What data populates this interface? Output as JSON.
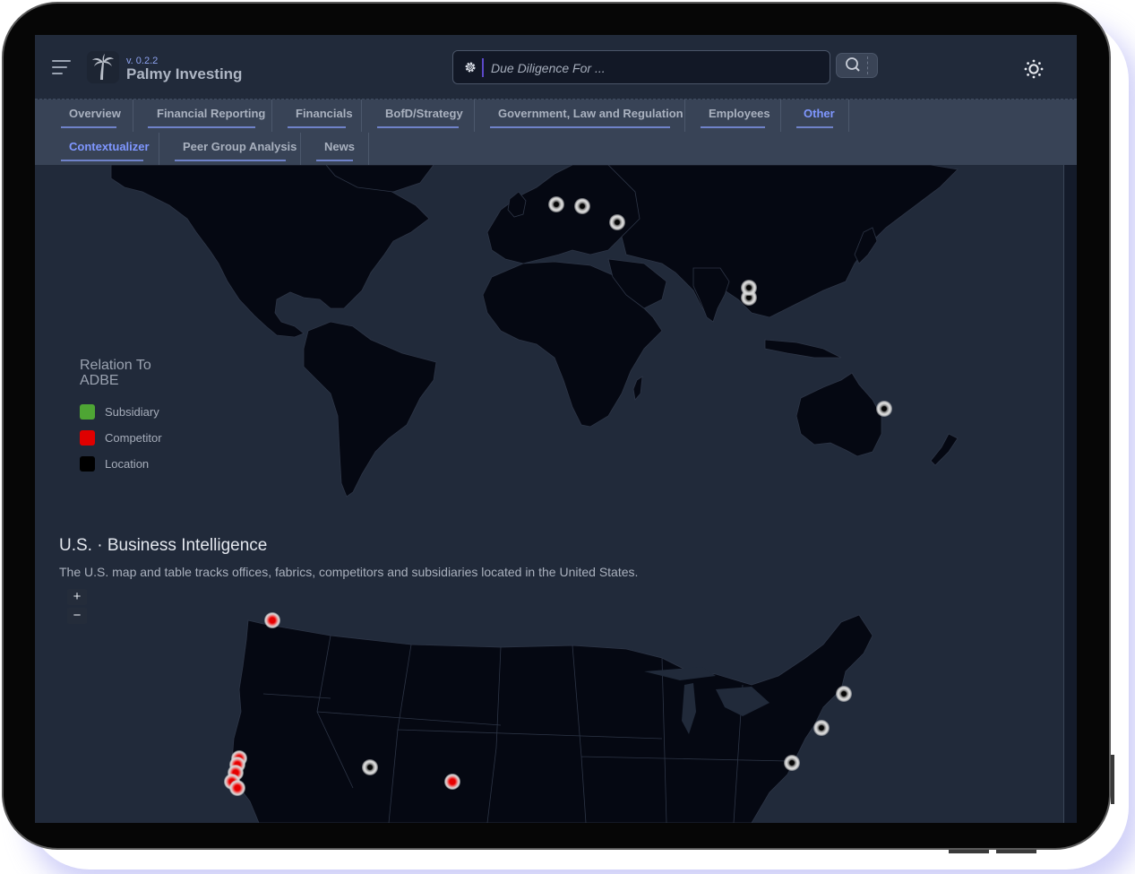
{
  "app": {
    "version": "v. 0.2.2",
    "title": "Palmy Investing"
  },
  "icons": {
    "menu": "hamburger-menu-icon",
    "logo": "palm-tree-icon",
    "search_settings": "gear-icon",
    "search": "magnifier-icon",
    "theme": "sun-icon"
  },
  "search": {
    "placeholder": "Due Diligence For ...",
    "value": ""
  },
  "tabs": {
    "row1": [
      {
        "label": "Overview",
        "active": false
      },
      {
        "label": "Financial Reporting",
        "active": false
      },
      {
        "label": "Financials",
        "active": false
      },
      {
        "label": "BofD/Strategy",
        "active": false
      },
      {
        "label": "Government, Law and Regulation",
        "active": false
      },
      {
        "label": "Employees",
        "active": false
      },
      {
        "label": "Other",
        "active": true
      }
    ],
    "row2": [
      {
        "label": "Contextualizer",
        "active": true
      },
      {
        "label": "Peer Group Analysis",
        "active": false
      },
      {
        "label": "News",
        "active": false
      }
    ]
  },
  "legend": {
    "title": "Relation To ADBE",
    "items": [
      {
        "label": "Subsidiary",
        "color": "#4ea534"
      },
      {
        "label": "Competitor",
        "color": "#e00000"
      },
      {
        "label": "Location",
        "color": "#000000"
      }
    ]
  },
  "world_map": {
    "markers": [
      {
        "region": "United Kingdom",
        "type": "location",
        "x": 0.507,
        "y": 0.115
      },
      {
        "region": "Germany",
        "type": "location",
        "x": 0.532,
        "y": 0.12
      },
      {
        "region": "Romania",
        "type": "location",
        "x": 0.566,
        "y": 0.168
      },
      {
        "region": "India",
        "type": "location",
        "x": 0.694,
        "y": 0.39
      },
      {
        "region": "India",
        "type": "location",
        "x": 0.694,
        "y": 0.36
      },
      {
        "region": "Australia",
        "type": "location",
        "x": 0.826,
        "y": 0.715
      }
    ]
  },
  "us_section": {
    "title": "U.S. · Business Intelligence",
    "description": "The U.S. map and table tracks offices, fabrics, competitors and subsidiaries located in the United States.",
    "zoom_in": "+",
    "zoom_out": "−"
  },
  "us_map": {
    "markers": [
      {
        "region": "Washington",
        "type": "competitor",
        "x": 0.231,
        "y": 0.075
      },
      {
        "region": "California",
        "type": "competitor",
        "x": 0.199,
        "y": 0.705
      },
      {
        "region": "California",
        "type": "competitor",
        "x": 0.197,
        "y": 0.735
      },
      {
        "region": "California",
        "type": "competitor",
        "x": 0.195,
        "y": 0.77
      },
      {
        "region": "California",
        "type": "competitor",
        "x": 0.192,
        "y": 0.81
      },
      {
        "region": "California",
        "type": "competitor",
        "x": 0.197,
        "y": 0.84
      },
      {
        "region": "Utah",
        "type": "location",
        "x": 0.326,
        "y": 0.745
      },
      {
        "region": "Colorado",
        "type": "competitor",
        "x": 0.406,
        "y": 0.81
      },
      {
        "region": "Massachusetts",
        "type": "location",
        "x": 0.787,
        "y": 0.41
      },
      {
        "region": "New York",
        "type": "location",
        "x": 0.765,
        "y": 0.566
      },
      {
        "region": "Virginia",
        "type": "location",
        "x": 0.736,
        "y": 0.727
      }
    ]
  }
}
